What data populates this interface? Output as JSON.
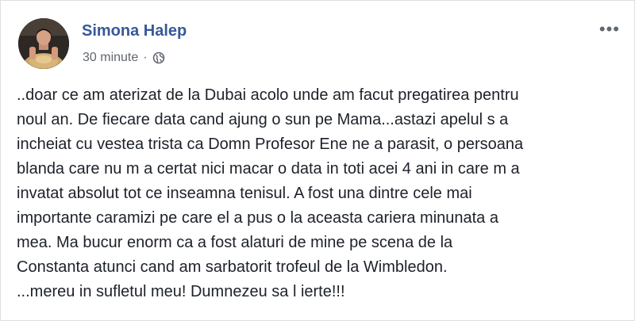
{
  "post": {
    "author": "Simona Halep",
    "time": "30 minute",
    "separator": "·",
    "privacy_icon": "globe-icon",
    "more_icon": "more-options-icon",
    "more_glyph": "•••",
    "lines": [
      "..doar ce am aterizat de la Dubai acolo unde am facut pregatirea pentru",
      "noul an. De fiecare data cand ajung o sun pe Mama...astazi apelul s a",
      "incheiat cu vestea trista ca Domn Profesor Ene ne a parasit, o persoana",
      "blanda care nu m a certat nici macar o data in toti acei 4 ani in care m a",
      "invatat absolut tot ce inseamna tenisul. A fost una dintre cele mai",
      "importante caramizi pe care el a pus o la aceasta cariera minunata a",
      "mea. Ma bucur enorm ca a fost alaturi de mine pe scena de la",
      "Constanta atunci cand am sarbatorit trofeul de la Wimbledon.",
      "...mereu in sufletul meu! Dumnezeu sa l ierte!!!"
    ]
  },
  "colors": {
    "author": "#385898",
    "meta": "#616770",
    "text": "#1d2129",
    "background": "#ffffff"
  }
}
